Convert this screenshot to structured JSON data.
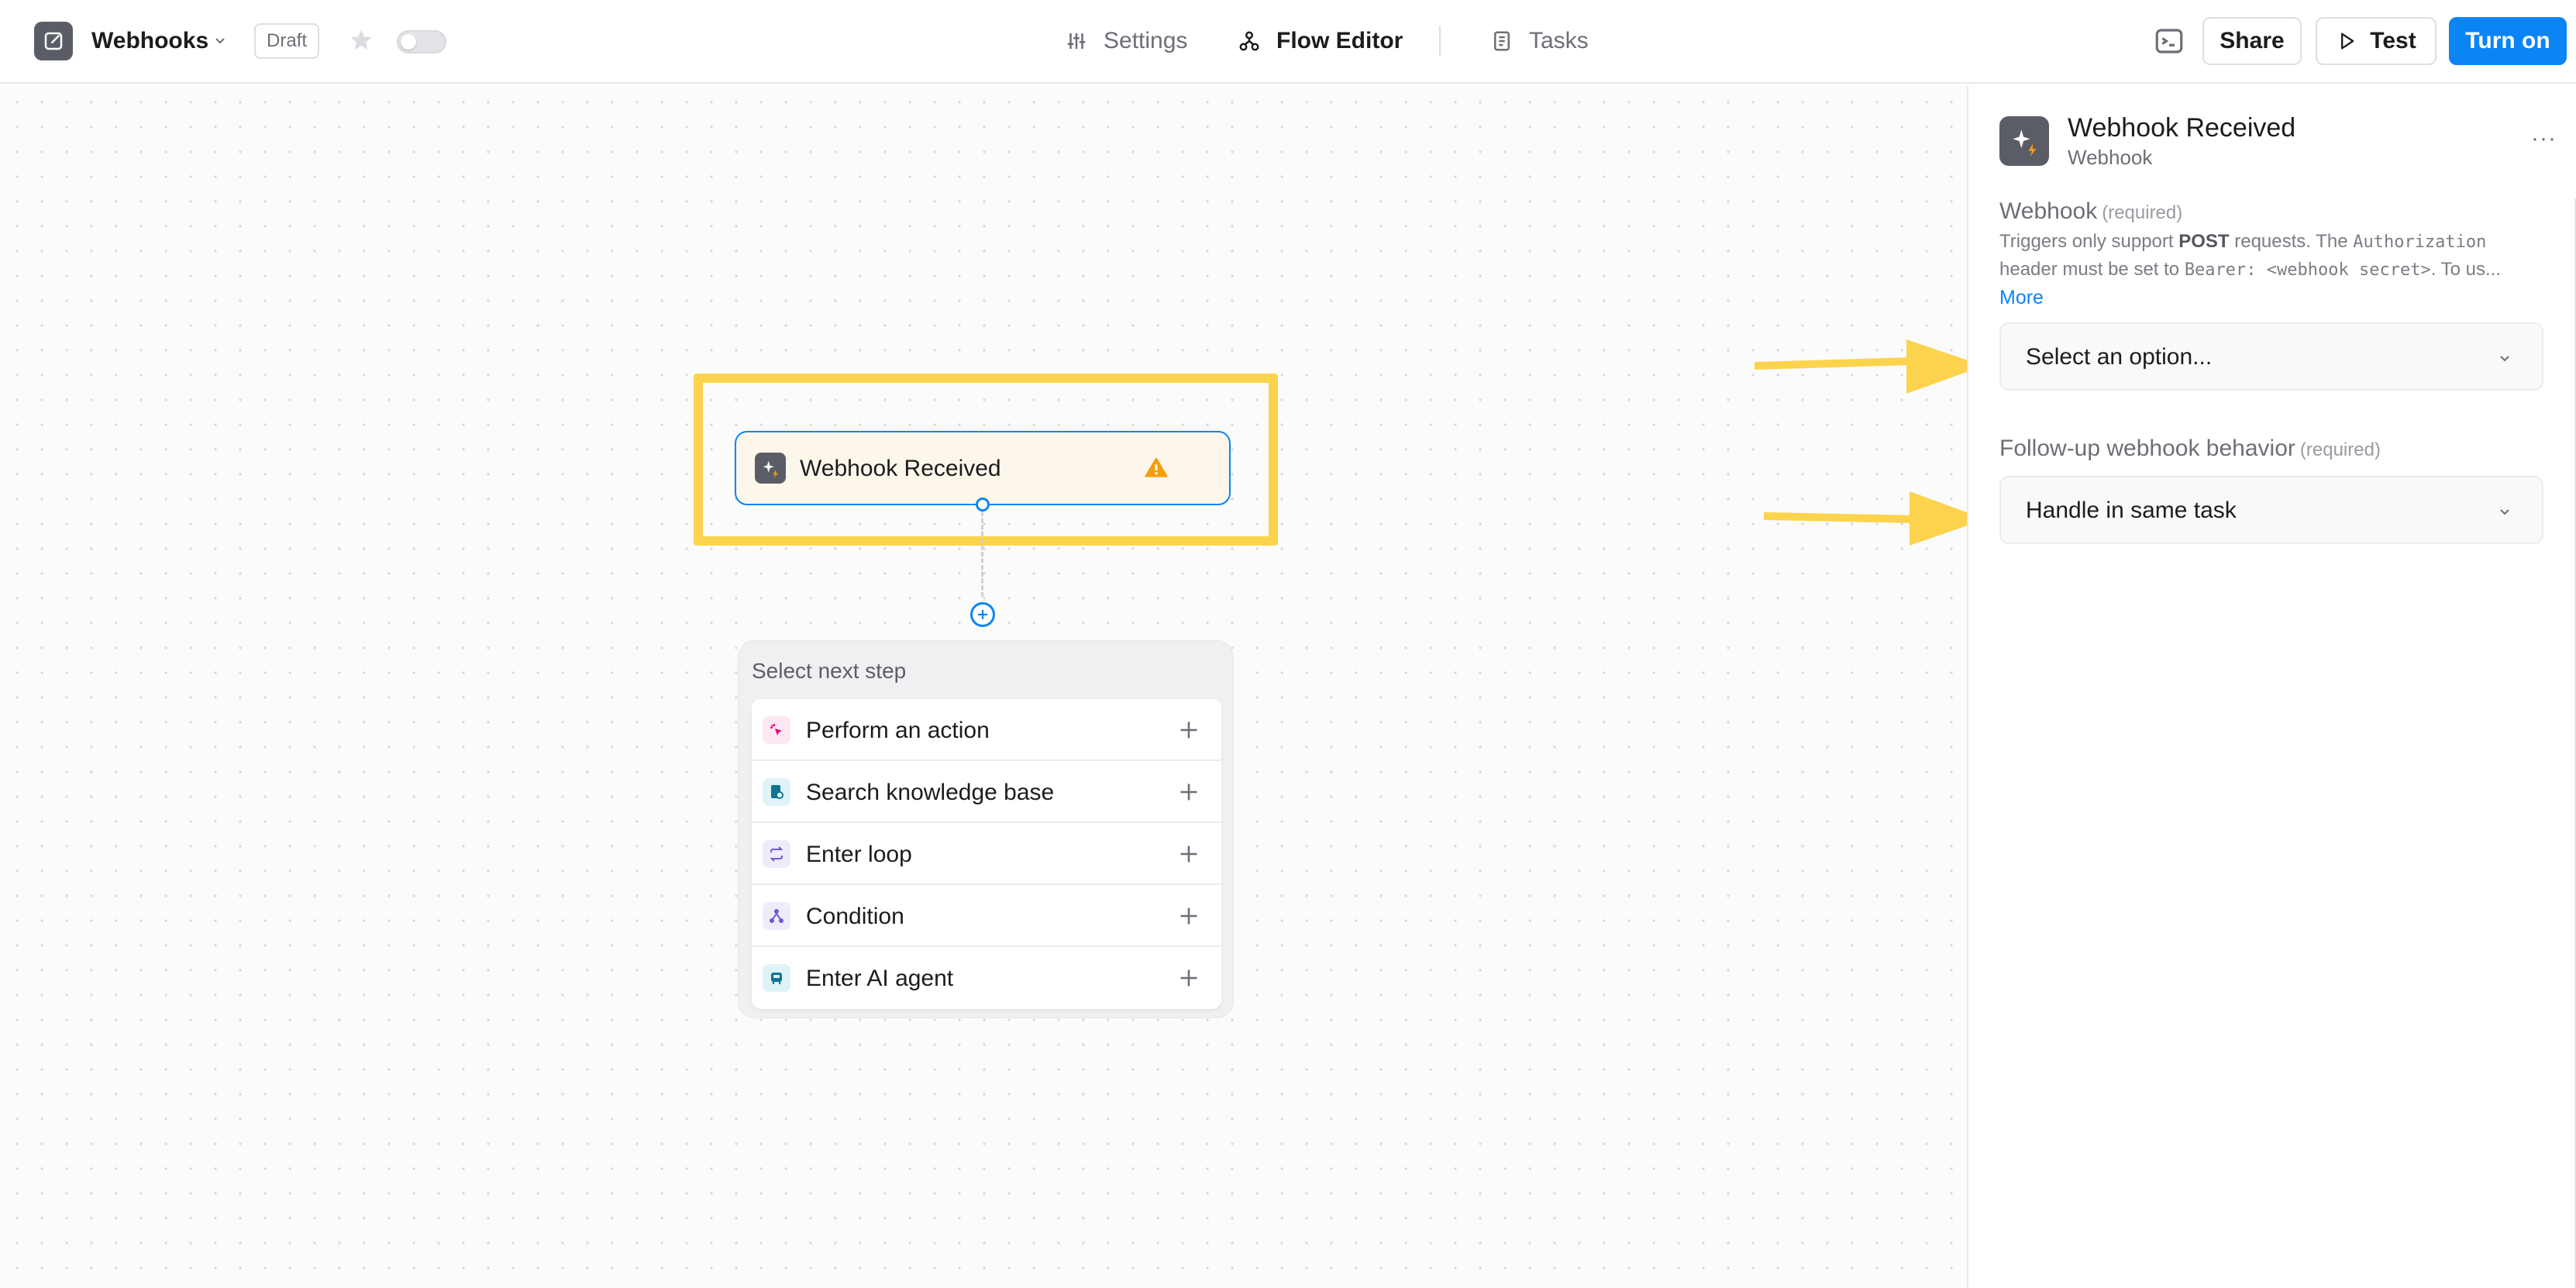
{
  "header": {
    "app_name": "Webhooks",
    "status_badge": "Draft",
    "nav": {
      "settings": "Settings",
      "flow_editor": "Flow Editor",
      "tasks": "Tasks"
    },
    "share_label": "Share",
    "test_label": "Test",
    "turn_on_label": "Turn on"
  },
  "canvas": {
    "trigger_node": {
      "label": "Webhook Received",
      "status": "warning"
    },
    "next_step": {
      "title": "Select next step",
      "items": [
        {
          "label": "Perform an action",
          "icon": "sparkle-cursor-icon",
          "color": "#e6007e"
        },
        {
          "label": "Search knowledge base",
          "icon": "knowledge-base-icon",
          "color": "#0e7490"
        },
        {
          "label": "Enter loop",
          "icon": "loop-icon",
          "color": "#6d5bd0"
        },
        {
          "label": "Condition",
          "icon": "condition-icon",
          "color": "#6d5bd0"
        },
        {
          "label": "Enter AI agent",
          "icon": "robot-icon",
          "color": "#0e7490"
        }
      ]
    }
  },
  "panel": {
    "title": "Webhook Received",
    "subtitle": "Webhook",
    "more_menu": "···",
    "webhook_field": {
      "label": "Webhook",
      "required": "(required)",
      "help_1_a": "Triggers only support ",
      "help_1_b": "POST",
      "help_1_c": " requests. The ",
      "help_1_d": "Authorization",
      "help_2_a": "header must be set to ",
      "help_2_b": "Bearer: <webhook secret>",
      "help_2_c": ". To us...",
      "more_link": "More",
      "value": "Select an option..."
    },
    "followup_field": {
      "label": "Follow-up webhook behavior",
      "required": "(required)",
      "value": "Handle in same task"
    }
  },
  "colors": {
    "accent": "#0b84f4",
    "highlight": "#fcd34d",
    "warning": "#f59e0b"
  }
}
